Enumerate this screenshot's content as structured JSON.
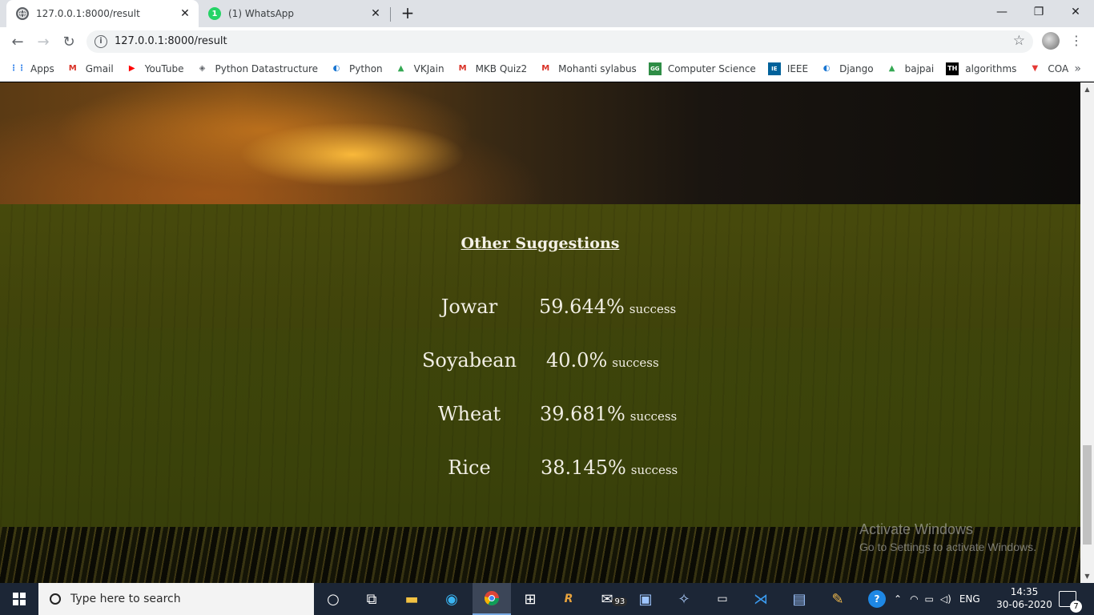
{
  "browser": {
    "tabs": [
      {
        "title": "127.0.0.1:8000/result",
        "active": true,
        "icon": "globe-icon"
      },
      {
        "title": "(1) WhatsApp",
        "active": false,
        "icon": "whatsapp-icon",
        "badge": "1"
      }
    ],
    "new_tab_label": "+",
    "url": "127.0.0.1:8000/result",
    "bookmarks": [
      {
        "label": "Apps",
        "icon": "apps-grid-icon",
        "color": "#1a73e8"
      },
      {
        "label": "Gmail",
        "icon": "gmail-icon",
        "color": "#d93025"
      },
      {
        "label": "YouTube",
        "icon": "youtube-icon",
        "color": "#ff0000"
      },
      {
        "label": "Python Datastructure",
        "icon": "diamond-icon",
        "color": "#5f6368"
      },
      {
        "label": "Python",
        "icon": "python-icon",
        "color": "#1976d2"
      },
      {
        "label": "VKJain",
        "icon": "drive-icon",
        "color": "#34a853"
      },
      {
        "label": "MKB Quiz2",
        "icon": "gmail-icon",
        "color": "#d93025"
      },
      {
        "label": "Mohanti sylabus",
        "icon": "gmail-icon",
        "color": "#d93025"
      },
      {
        "label": "Computer Science",
        "icon": "geeks-icon",
        "color": "#2f8d46"
      },
      {
        "label": "IEEE",
        "icon": "ieee-icon",
        "color": "#00629b"
      },
      {
        "label": "Django",
        "icon": "python-icon",
        "color": "#1976d2"
      },
      {
        "label": "bajpai",
        "icon": "drive-icon",
        "color": "#34a853"
      },
      {
        "label": "algorithms",
        "icon": "th-icon",
        "color": "#000000"
      },
      {
        "label": "COA",
        "icon": "triangle-icon",
        "color": "#e53935"
      }
    ],
    "bookmarks_more": "»"
  },
  "page": {
    "section_title": "Other Suggestions",
    "success_word": "success",
    "suggestions": [
      {
        "crop": "Jowar",
        "percent": "59.644%"
      },
      {
        "crop": "Soyabean",
        "percent": "40.0%"
      },
      {
        "crop": "Wheat",
        "percent": "39.681%"
      },
      {
        "crop": "Rice",
        "percent": "38.145%"
      }
    ],
    "watermark_title": "Activate Windows",
    "watermark_sub": "Go to Settings to activate Windows."
  },
  "taskbar": {
    "search_placeholder": "Type here to search",
    "mail_badge": "93",
    "language": "ENG",
    "time": "14:35",
    "date": "30-06-2020",
    "notification_count": "7"
  },
  "colors": {
    "panel": "#4a4e0c",
    "text": "#f1eee4",
    "taskbar": "#1c2636"
  }
}
